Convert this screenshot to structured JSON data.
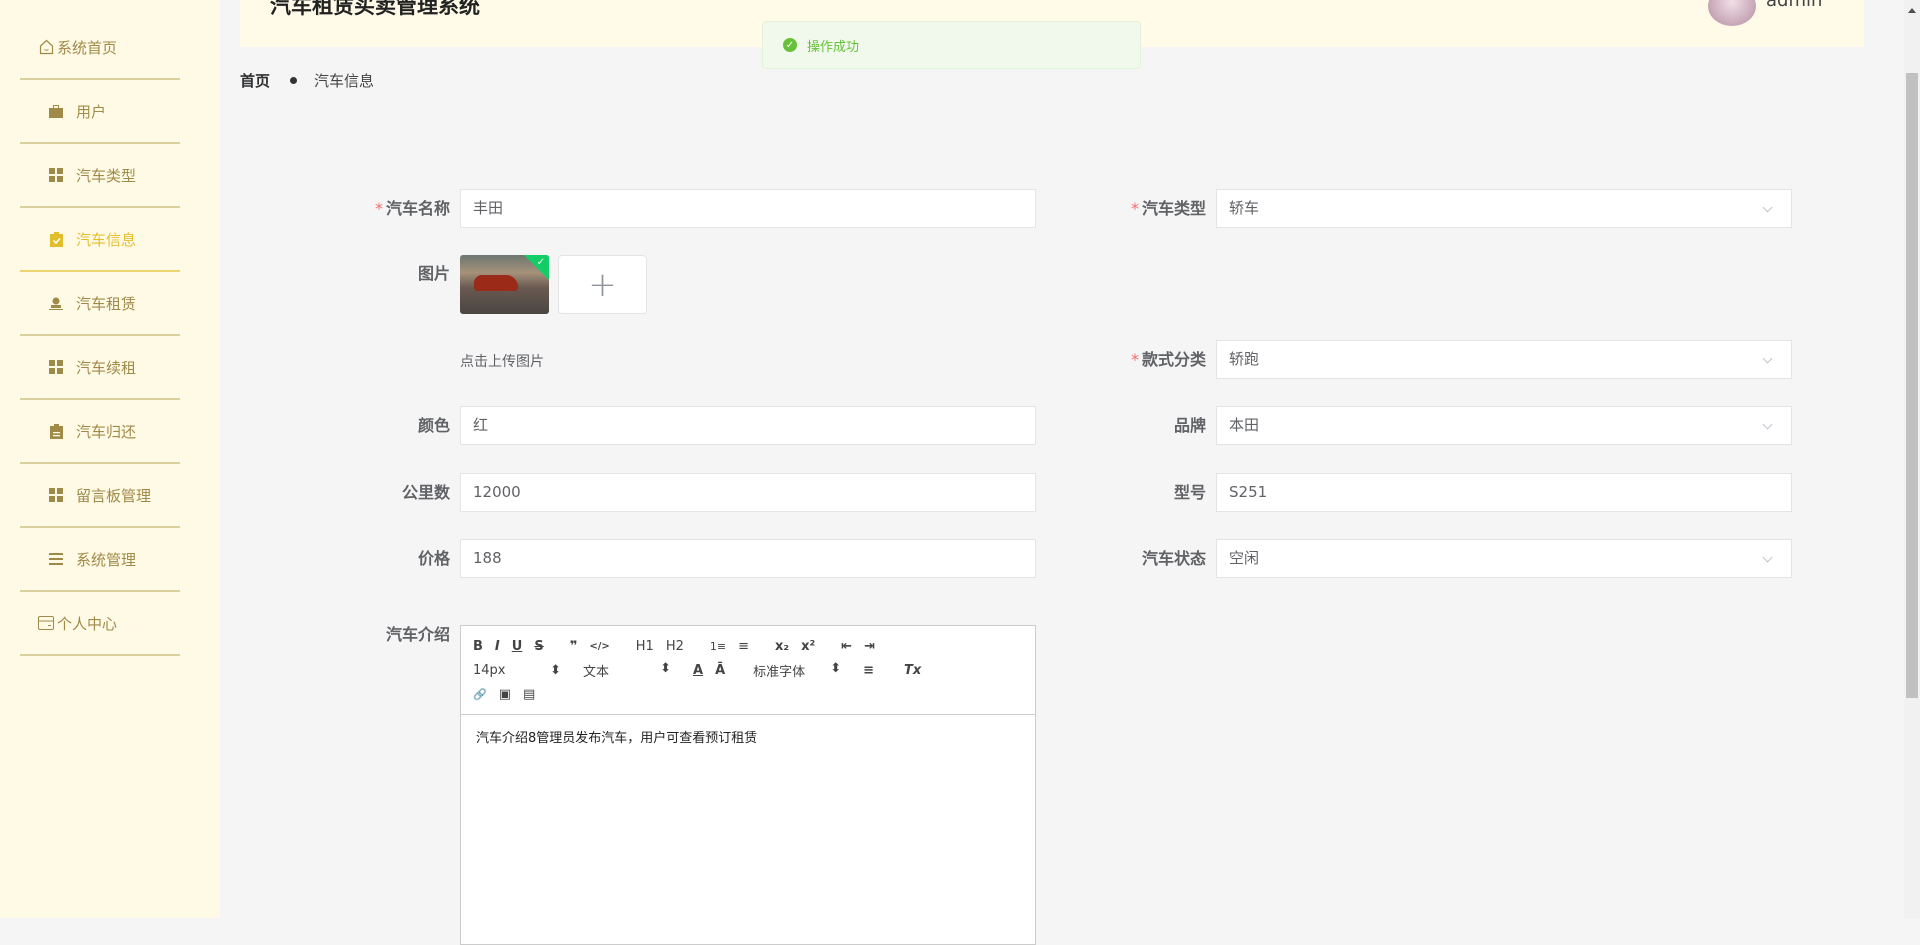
{
  "header": {
    "title": "汽车租赁买卖管理系统",
    "username": "admin"
  },
  "toast": {
    "message": "操作成功"
  },
  "sidebar": {
    "items": [
      {
        "label": "系统首页",
        "icon": "home-icon"
      },
      {
        "label": "用户",
        "icon": "briefcase-icon"
      },
      {
        "label": "汽车类型",
        "icon": "grid-icon"
      },
      {
        "label": "汽车信息",
        "icon": "clipboard-check-icon"
      },
      {
        "label": "汽车租赁",
        "icon": "user-icon"
      },
      {
        "label": "汽车续租",
        "icon": "grid-icon"
      },
      {
        "label": "汽车归还",
        "icon": "clipboard-icon"
      },
      {
        "label": "留言板管理",
        "icon": "grid-icon"
      },
      {
        "label": "系统管理",
        "icon": "menu-icon"
      },
      {
        "label": "个人中心",
        "icon": "card-icon"
      }
    ],
    "active": "汽车信息"
  },
  "breadcrumb": {
    "home": "首页",
    "current": "汽车信息"
  },
  "form": {
    "name": {
      "label": "汽车名称",
      "value": "丰田",
      "required": true
    },
    "type": {
      "label": "汽车类型",
      "value": "轿车",
      "required": true
    },
    "image": {
      "label": "图片",
      "hint": "点击上传图片",
      "add": "+"
    },
    "style": {
      "label": "款式分类",
      "value": "轿跑",
      "required": true
    },
    "color": {
      "label": "颜色",
      "value": "红"
    },
    "brand": {
      "label": "品牌",
      "value": "本田"
    },
    "mileage": {
      "label": "公里数",
      "value": "12000"
    },
    "model": {
      "label": "型号",
      "value": "S251"
    },
    "price": {
      "label": "价格",
      "value": "188"
    },
    "status": {
      "label": "汽车状态",
      "value": "空闲"
    },
    "intro": {
      "label": "汽车介绍",
      "content": "汽车介绍8管理员发布汽车，用户可查看预订租赁"
    },
    "required_mark": "*"
  },
  "editor": {
    "buttons1": [
      "B",
      "I",
      "U",
      "S",
      "❞",
      "</>",
      "H1",
      "H2",
      "1≡",
      "≡",
      "x₂",
      "x²",
      "⇤",
      "⇥"
    ],
    "size": "14px",
    "format": "文本",
    "font": "标准字体",
    "buttons2": [
      "A",
      "Ā",
      "≡",
      "Tx"
    ],
    "buttons3": [
      "🔗",
      "▣",
      "▤"
    ],
    "arrows": "⬍"
  },
  "colors": {
    "accent": "#e3be2c",
    "sidebar_text": "#a08a48",
    "sidebar_bg": "#fffae6",
    "success": "#67c23a"
  }
}
